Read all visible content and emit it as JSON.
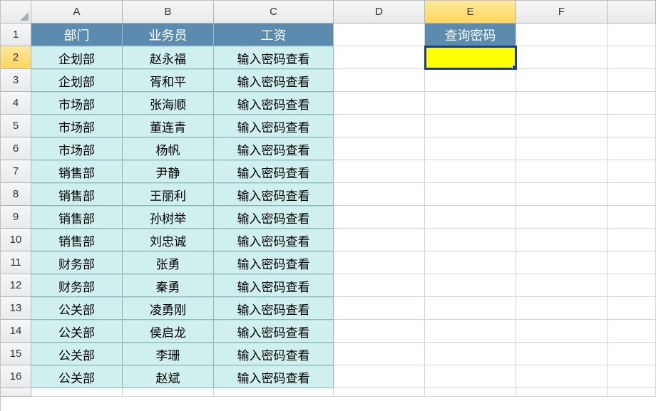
{
  "columns": [
    "A",
    "B",
    "C",
    "D",
    "E",
    "F",
    ""
  ],
  "rowNumbers": [
    1,
    2,
    3,
    4,
    5,
    6,
    7,
    8,
    9,
    10,
    11,
    12,
    13,
    14,
    15,
    16,
    ""
  ],
  "headers": {
    "dept": "部门",
    "sales": "业务员",
    "salary": "工资"
  },
  "query": {
    "label": "查询密码",
    "value": ""
  },
  "salaryText": "输入密码查看",
  "rows": [
    {
      "dept": "企划部",
      "name": "赵永福"
    },
    {
      "dept": "企划部",
      "name": "胥和平"
    },
    {
      "dept": "市场部",
      "name": "张海顺"
    },
    {
      "dept": "市场部",
      "name": "董连青"
    },
    {
      "dept": "市场部",
      "name": "杨帆"
    },
    {
      "dept": "销售部",
      "name": "尹静"
    },
    {
      "dept": "销售部",
      "name": "王丽利"
    },
    {
      "dept": "销售部",
      "name": "孙树举"
    },
    {
      "dept": "销售部",
      "name": "刘忠诚"
    },
    {
      "dept": "财务部",
      "name": "张勇"
    },
    {
      "dept": "财务部",
      "name": "秦勇"
    },
    {
      "dept": "公关部",
      "name": "凌勇刚"
    },
    {
      "dept": "公关部",
      "name": "侯启龙"
    },
    {
      "dept": "公关部",
      "name": "李珊"
    },
    {
      "dept": "公关部",
      "name": "赵斌"
    }
  ],
  "selectedCell": "E2"
}
